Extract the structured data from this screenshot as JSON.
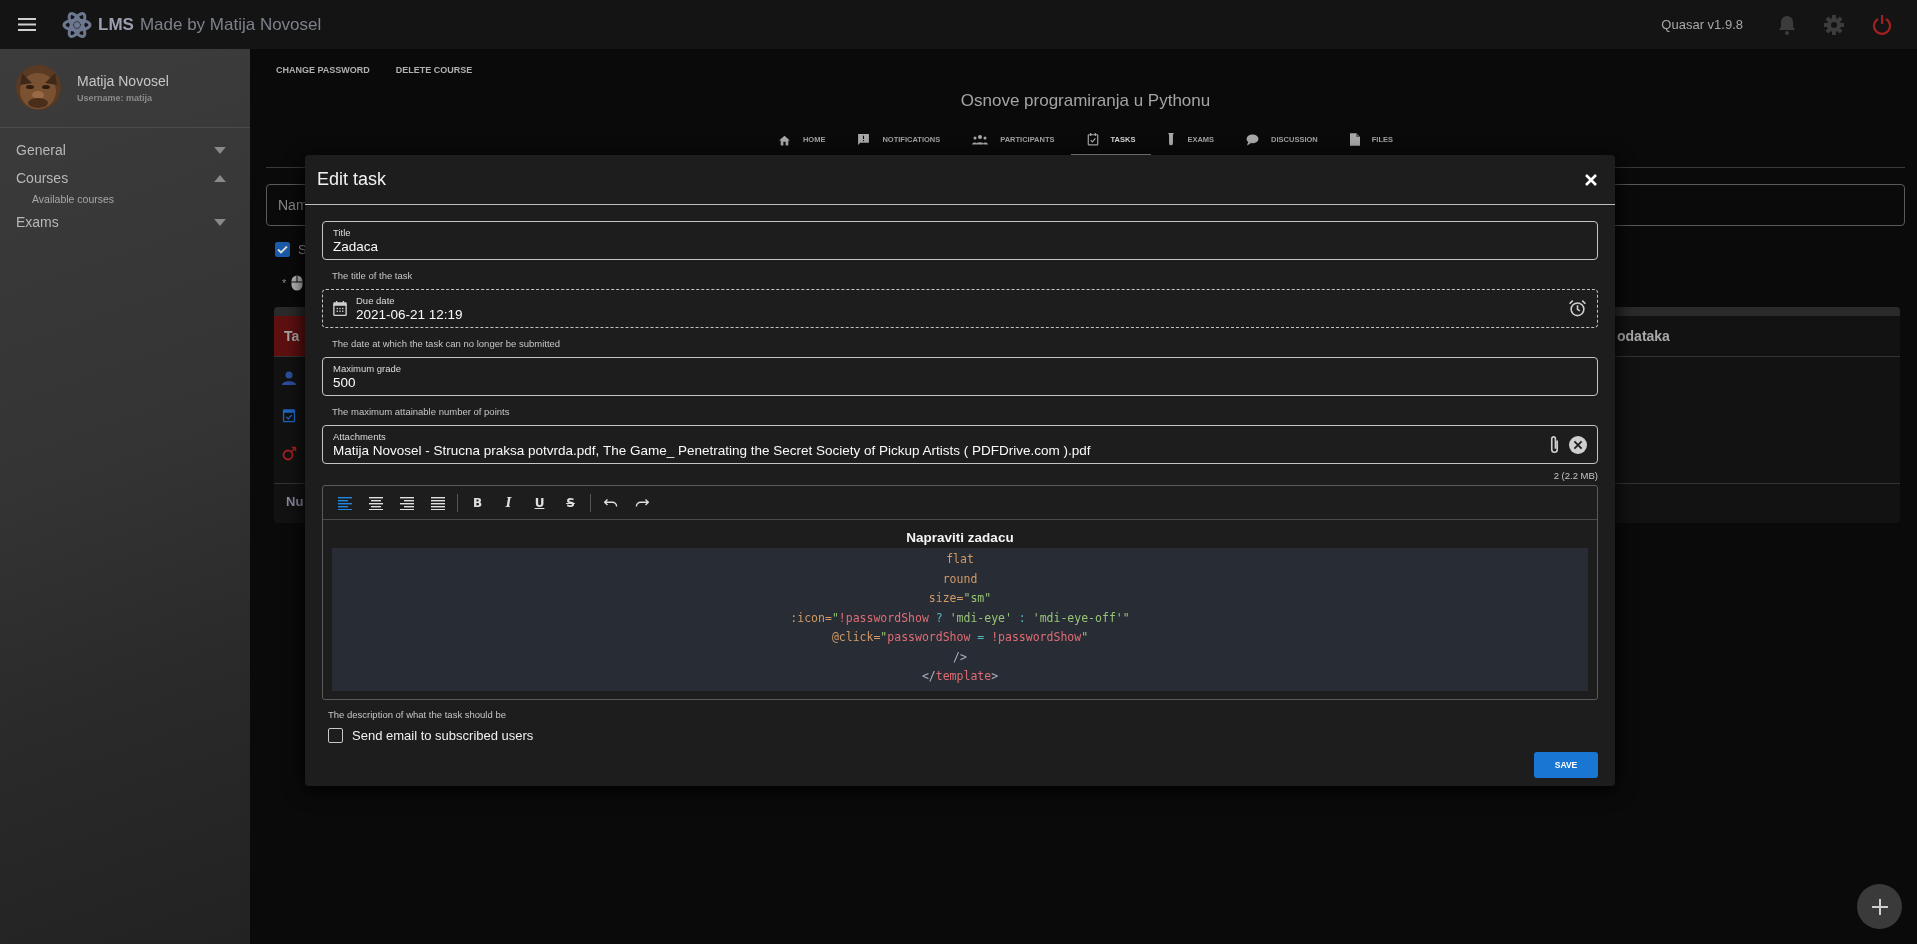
{
  "app_bar": {
    "brand": "LMS",
    "subtitle": "Made by Matija Novosel",
    "version": "Quasar v1.9.8"
  },
  "sidebar": {
    "user_name": "Matija Novosel",
    "username": "Username: matija",
    "items": [
      {
        "label": "General",
        "expanded": false
      },
      {
        "label": "Courses",
        "expanded": true,
        "children": [
          {
            "label": "Available courses"
          }
        ]
      },
      {
        "label": "Exams",
        "expanded": false
      }
    ]
  },
  "course": {
    "actions": [
      "CHANGE PASSWORD",
      "DELETE COURSE"
    ],
    "title": "Osnove programiranja u Pythonu",
    "tabs": [
      {
        "kind": "home",
        "label": "HOME",
        "selected": false
      },
      {
        "kind": "notifications",
        "label": "NOTIFICATIONS",
        "selected": false
      },
      {
        "kind": "participants",
        "label": "PARTICIPANTS",
        "selected": false
      },
      {
        "kind": "tasks",
        "label": "TASKS",
        "selected": true
      },
      {
        "kind": "exams",
        "label": "EXAMS",
        "selected": false
      },
      {
        "kind": "discussion",
        "label": "DISCUSSION",
        "selected": false
      },
      {
        "kind": "files",
        "label": "FILES",
        "selected": false
      }
    ],
    "name_field": {
      "label": "Nam"
    },
    "filter": {
      "label": "S",
      "checked": true
    },
    "hint_marker": "*",
    "table": {
      "columns": [
        "Ta",
        "odataka"
      ],
      "footer": "Nu"
    }
  },
  "dialog": {
    "title": "Edit task",
    "fields": [
      {
        "kind": "text",
        "label": "Title",
        "value": "Zadaca",
        "hint": "The title of the task"
      },
      {
        "kind": "date",
        "label": "Due date",
        "value": "2021-06-21 12:19",
        "hint": "The date at which the task can no longer be submitted"
      },
      {
        "kind": "text",
        "label": "Maximum grade",
        "value": "500",
        "hint": "The maximum attainable number of points"
      },
      {
        "kind": "file",
        "label": "Attachments",
        "value": "Matija Novosel - Strucna praksa potvrda.pdf, The Game_ Penetrating the Secret Society of Pickup Artists ( PDFDrive.com ).pdf",
        "counter": "2 (2.2 MB)"
      }
    ],
    "editor": {
      "toolbar": [
        {
          "kind": "align-left",
          "selected": true
        },
        {
          "kind": "align-center",
          "selected": false
        },
        {
          "kind": "align-right",
          "selected": false
        },
        {
          "kind": "align-justify",
          "selected": false
        },
        {
          "kind": "bold",
          "label": "B",
          "selected": false
        },
        {
          "kind": "italic",
          "label": "I",
          "selected": false
        },
        {
          "kind": "underline",
          "label": "U",
          "selected": false
        },
        {
          "kind": "strike",
          "label": "S",
          "selected": false
        },
        {
          "kind": "undo",
          "selected": false
        },
        {
          "kind": "redo",
          "selected": false
        }
      ],
      "heading": "Napraviti zadacu",
      "code": [
        [
          {
            "kind": "attr",
            "text": "flat"
          }
        ],
        [
          {
            "kind": "attr",
            "text": "round"
          }
        ],
        [
          {
            "kind": "attr",
            "text": "size="
          },
          {
            "kind": "string",
            "text": "\"sm\""
          }
        ],
        [
          {
            "kind": "attr",
            "text": ":icon="
          },
          {
            "kind": "string",
            "text": "\""
          },
          {
            "kind": "var",
            "text": "!passwordShow"
          },
          {
            "kind": "op",
            "text": " ? "
          },
          {
            "kind": "string",
            "text": "'mdi-eye'"
          },
          {
            "kind": "op",
            "text": " : "
          },
          {
            "kind": "string",
            "text": "'mdi-eye-off'\""
          }
        ],
        [
          {
            "kind": "attr",
            "text": "@click="
          },
          {
            "kind": "string",
            "text": "\""
          },
          {
            "kind": "var",
            "text": "passwordShow"
          },
          {
            "kind": "op",
            "text": " = "
          },
          {
            "kind": "var",
            "text": "!passwordShow"
          },
          {
            "kind": "string",
            "text": "\""
          }
        ],
        [
          {
            "kind": "punct",
            "text": "/>"
          }
        ],
        [
          {
            "kind": "punct",
            "text": "</"
          },
          {
            "kind": "var",
            "text": "template"
          },
          {
            "kind": "punct",
            "text": ">"
          }
        ]
      ]
    },
    "editor_hint": "The description of what the task should be",
    "send_email": {
      "label": "Send email to subscribed users",
      "checked": false
    },
    "save": "SAVE"
  }
}
